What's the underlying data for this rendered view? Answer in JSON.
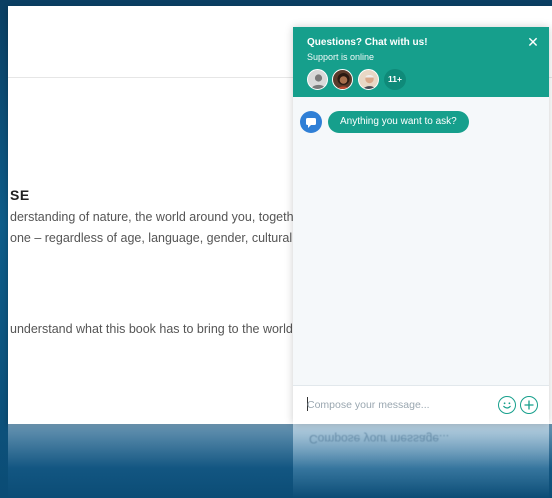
{
  "background_page": {
    "heading": "SE",
    "paragraph_line_1": "derstanding of nature, the world around you, together",
    "paragraph_line_2": "one – regardless of age, language, gender, cultural or r",
    "paragraph_line_3": "understand what this book has to bring to the world a"
  },
  "chat": {
    "title": "Questions? Chat with us!",
    "status": "Support is online",
    "close_icon": "close-icon",
    "avatar_more": "11+",
    "messages": [
      {
        "text": "Anything you want to ask?"
      }
    ],
    "compose": {
      "placeholder": "Compose your message...",
      "emoji_icon": "smiley-icon",
      "attach_icon": "plus-icon"
    }
  },
  "colors": {
    "accent": "#169f8c",
    "bot_icon": "#2f7fd6",
    "desktop_background": "#0b3f63"
  }
}
